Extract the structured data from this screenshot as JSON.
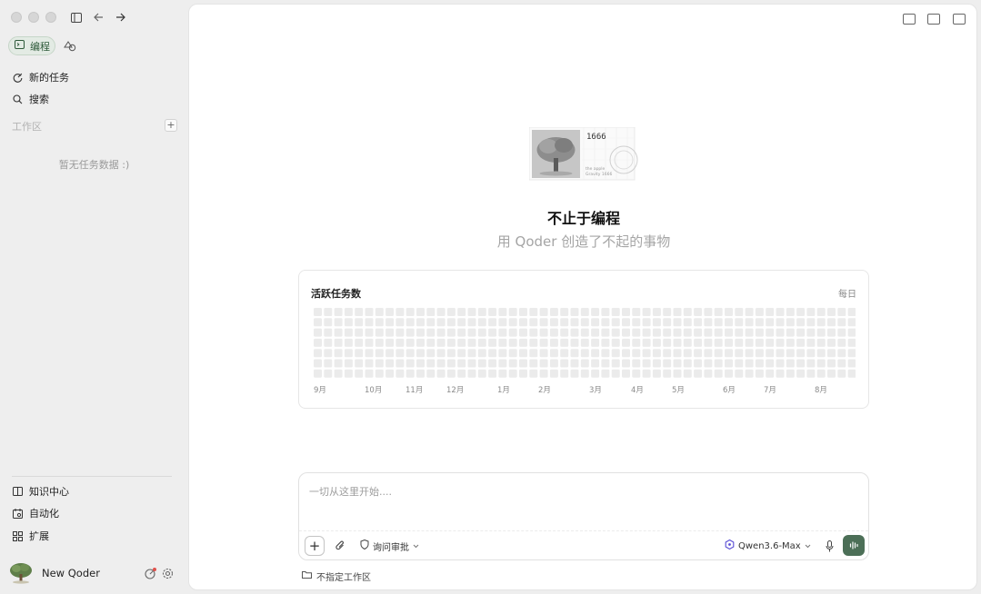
{
  "sidebar": {
    "mode_label": "编程",
    "nav": [
      {
        "label": "新的任务",
        "icon": "new-task-icon"
      },
      {
        "label": "搜索",
        "icon": "search-icon"
      }
    ],
    "workspace_label": "工作区",
    "workspace_add": "+",
    "empty_message": "暂无任务数据 :)",
    "bottom": [
      {
        "label": "知识中心",
        "icon": "book-icon"
      },
      {
        "label": "自动化",
        "icon": "calendar-icon"
      },
      {
        "label": "扩展",
        "icon": "grid-icon"
      }
    ],
    "user_name": "New Qoder"
  },
  "main": {
    "hero_card_text": "1666",
    "hero_caption_1": "the apple",
    "hero_caption_2": "Gravity 1666",
    "title": "不止于编程",
    "subtitle": "用 Qoder 创造了不起的事物",
    "activity": {
      "title": "活跃任务数",
      "frequency": "每日",
      "months": [
        "9月",
        "10月",
        "11月",
        "12月",
        "1月",
        "2月",
        "3月",
        "4月",
        "5月",
        "6月",
        "7月",
        "8月"
      ]
    },
    "input": {
      "placeholder": "一切从这里开始....",
      "plus_label": "+",
      "approval_label": "询问审批",
      "model_label": "Qwen3.6-Max",
      "workspace_label": "不指定工作区"
    }
  },
  "colors": {
    "accent": "#4c6f57",
    "heatmap_cell": "#ebebeb",
    "badge": "#e0524c"
  }
}
